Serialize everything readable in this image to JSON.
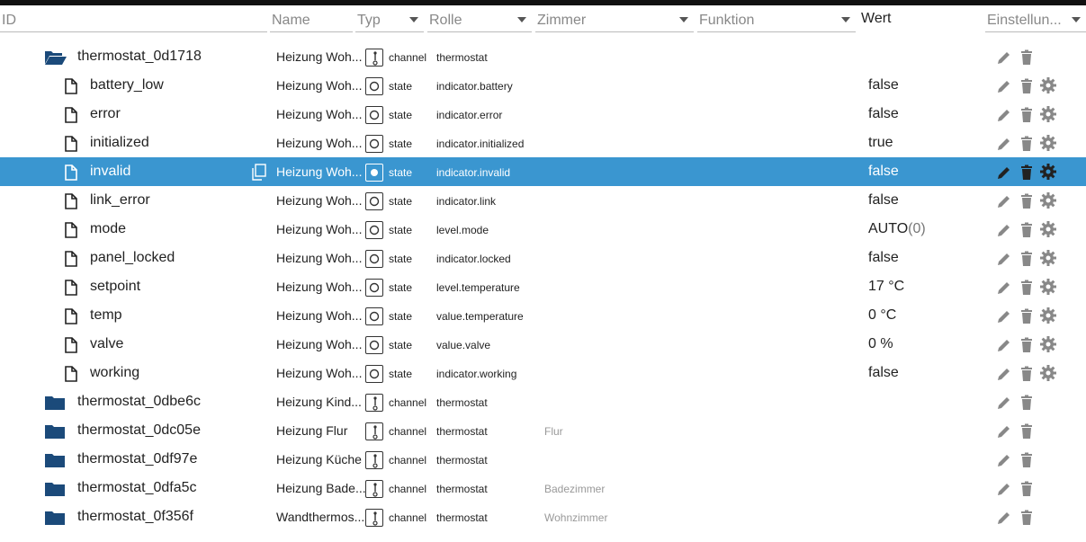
{
  "header": {
    "id_placeholder": "ID",
    "name_placeholder": "Name",
    "typ_label": "Typ",
    "rolle_label": "Rolle",
    "zimmer_label": "Zimmer",
    "funktion_label": "Funktion",
    "wert_label": "Wert",
    "einstellungen_label": "Einstellun..."
  },
  "colors": {
    "selected_row": "#3a96d0",
    "folder": "#1b4a7a"
  },
  "rows": [
    {
      "id": "thermostat_0d1718",
      "kind": "folder-open",
      "name": "Heizung Woh...",
      "type": "channel",
      "role": "thermostat",
      "room": "",
      "value": "",
      "unit": "",
      "settings": false
    },
    {
      "id": "battery_low",
      "kind": "file",
      "name": "Heizung Woh...",
      "type": "state",
      "role": "indicator.battery",
      "room": "",
      "value": "false",
      "unit": "",
      "settings": true
    },
    {
      "id": "error",
      "kind": "file",
      "name": "Heizung Woh...",
      "type": "state",
      "role": "indicator.error",
      "room": "",
      "value": "false",
      "unit": "",
      "settings": true
    },
    {
      "id": "initialized",
      "kind": "file",
      "name": "Heizung Woh...",
      "type": "state",
      "role": "indicator.initialized",
      "room": "",
      "value": "true",
      "unit": "",
      "settings": true
    },
    {
      "id": "invalid",
      "kind": "file",
      "name": "Heizung Woh...",
      "type": "state",
      "role": "indicator.invalid",
      "room": "",
      "value": "false",
      "unit": "",
      "settings": true,
      "selected": true
    },
    {
      "id": "link_error",
      "kind": "file",
      "name": "Heizung Woh...",
      "type": "state",
      "role": "indicator.link",
      "room": "",
      "value": "false",
      "unit": "",
      "settings": true
    },
    {
      "id": "mode",
      "kind": "file",
      "name": "Heizung Woh...",
      "type": "state",
      "role": "level.mode",
      "room": "",
      "value": "AUTO",
      "unit": "(0)",
      "settings": true
    },
    {
      "id": "panel_locked",
      "kind": "file",
      "name": "Heizung Woh...",
      "type": "state",
      "role": "indicator.locked",
      "room": "",
      "value": "false",
      "unit": "",
      "settings": true
    },
    {
      "id": "setpoint",
      "kind": "file",
      "name": "Heizung Woh...",
      "type": "state",
      "role": "level.temperature",
      "room": "",
      "value": "17 °C",
      "unit": "",
      "settings": true
    },
    {
      "id": "temp",
      "kind": "file",
      "name": "Heizung Woh...",
      "type": "state",
      "role": "value.temperature",
      "room": "",
      "value": "0 °C",
      "unit": "",
      "settings": true
    },
    {
      "id": "valve",
      "kind": "file",
      "name": "Heizung Woh...",
      "type": "state",
      "role": "value.valve",
      "room": "",
      "value": "0 %",
      "unit": "",
      "settings": true
    },
    {
      "id": "working",
      "kind": "file",
      "name": "Heizung Woh...",
      "type": "state",
      "role": "indicator.working",
      "room": "",
      "value": "false",
      "unit": "",
      "settings": true
    },
    {
      "id": "thermostat_0dbe6c",
      "kind": "folder",
      "name": "Heizung Kind...",
      "type": "channel",
      "role": "thermostat",
      "room": "",
      "value": "",
      "unit": "",
      "settings": false
    },
    {
      "id": "thermostat_0dc05e",
      "kind": "folder",
      "name": "Heizung Flur",
      "type": "channel",
      "role": "thermostat",
      "room": "Flur",
      "value": "",
      "unit": "",
      "settings": false
    },
    {
      "id": "thermostat_0df97e",
      "kind": "folder",
      "name": "Heizung Küche",
      "type": "channel",
      "role": "thermostat",
      "room": "",
      "value": "",
      "unit": "",
      "settings": false
    },
    {
      "id": "thermostat_0dfa5c",
      "kind": "folder",
      "name": "Heizung Bade...",
      "type": "channel",
      "role": "thermostat",
      "room": "Badezimmer",
      "value": "",
      "unit": "",
      "settings": false
    },
    {
      "id": "thermostat_0f356f",
      "kind": "folder",
      "name": "Wandthermos...",
      "type": "channel",
      "role": "thermostat",
      "room": "Wohnzimmer",
      "value": "",
      "unit": "",
      "settings": false
    }
  ]
}
